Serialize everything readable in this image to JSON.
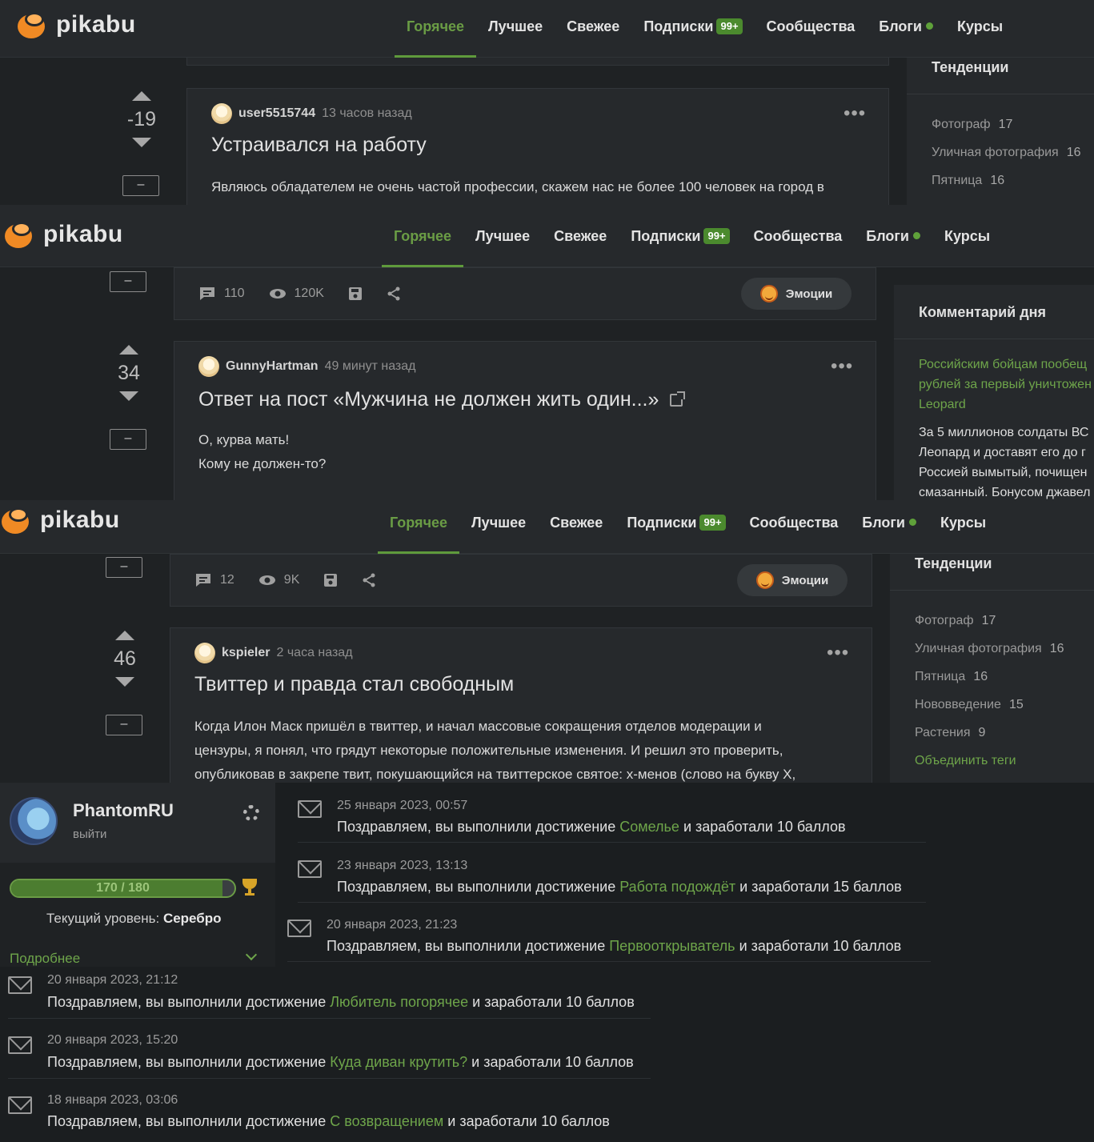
{
  "header": {
    "logo_text": "pikabu",
    "nav": [
      "Горячее",
      "Лучшее",
      "Свежее",
      "Подписки",
      "Сообщества",
      "Блоги",
      "Курсы"
    ],
    "subs_badge": "99+"
  },
  "panel1": {
    "rating": "-19",
    "collapse": "–",
    "post": {
      "author": "user5515744",
      "time": "13 часов назад",
      "title": "Устраивался на работу",
      "text": "Являюсь обладателем не очень частой профессии, скажем нас не более 100 человек на город в"
    },
    "sidebar_title": "Тенденции",
    "tags": [
      {
        "name": "Фотограф",
        "count": "17"
      },
      {
        "name": "Уличная фотография",
        "count": "16"
      },
      {
        "name": "Пятница",
        "count": "16"
      }
    ]
  },
  "panel2": {
    "collapse": "–",
    "actions": {
      "comments": "110",
      "views": "120K"
    },
    "emotions": "Эмоции",
    "rating": "34",
    "post": {
      "author": "GunnyHartman",
      "time": "49 минут назад",
      "title": "Ответ на пост «Мужчина не должен жить один...»",
      "text_lines": [
        "О, курва мать!",
        "Кому не должен-то?"
      ]
    },
    "sidebar_title": "Комментарий дня",
    "cod_link_lines": [
      "Российским бойцам пообещ",
      "рублей за первый уничтожен",
      "Leopard"
    ],
    "cod_text_lines": [
      "За 5 миллионов  солдаты ВС",
      "Леопард и доставят его до г",
      "Россией вымытый, почищен",
      "смазанный. Бонусом джавел"
    ]
  },
  "panel3": {
    "collapse": "–",
    "actions": {
      "comments": "12",
      "views": "9K"
    },
    "emotions": "Эмоции",
    "rating": "46",
    "post": {
      "author": "kspieler",
      "time": "2 часа назад",
      "title": "Твиттер и правда стал свободным",
      "text_lines": [
        "Когда Илон Маск пришёл в твиттер, и начал массовые сокращения отделов модерации и",
        "цензуры, я понял, что грядут некоторые положительные изменения. И решил это проверить,",
        "опубликовав в закрепе твит, покушающийся на твиттерское святое: х-менов (слово на букву Х,"
      ]
    },
    "sidebar_title": "Тенденции",
    "tags": [
      {
        "name": "Фотограф",
        "count": "17"
      },
      {
        "name": "Уличная фотография",
        "count": "16"
      },
      {
        "name": "Пятница",
        "count": "16"
      },
      {
        "name": "Нововведение",
        "count": "15"
      },
      {
        "name": "Растения",
        "count": "9"
      }
    ],
    "merge_tags": "Объединить теги"
  },
  "panel4": {
    "profile": {
      "name": "PhantomRU",
      "exit": "выйти"
    },
    "progress": {
      "label": "170 / 180",
      "value": 170,
      "max": 180
    },
    "level_prefix": "Текущий уровень:",
    "level_value": "Серебро",
    "more": "Подробнее",
    "msg_prefix": "Поздравляем, вы выполнили достижение",
    "notifications_right": [
      {
        "date": "25 января 2023, 00:57",
        "achievement": "Сомелье",
        "suffix": "и заработали 10 баллов"
      },
      {
        "date": "23 января 2023, 13:13",
        "achievement": "Работа подождёт",
        "suffix": "и заработали 15 баллов"
      },
      {
        "date": "20 января 2023, 21:23",
        "achievement": "Первооткрыватель",
        "suffix": "и заработали 10 баллов"
      }
    ],
    "notifications_left": [
      {
        "date": "20 января 2023, 21:12",
        "achievement": "Любитель погорячее",
        "suffix": "и заработали 10 баллов"
      },
      {
        "date": "20 января 2023, 15:20",
        "achievement": "Куда диван крутить?",
        "suffix": "и заработали 10 баллов"
      },
      {
        "date": "18 января 2023, 03:06",
        "achievement": "С возвращением",
        "suffix": "и заработали 10 баллов"
      }
    ]
  }
}
